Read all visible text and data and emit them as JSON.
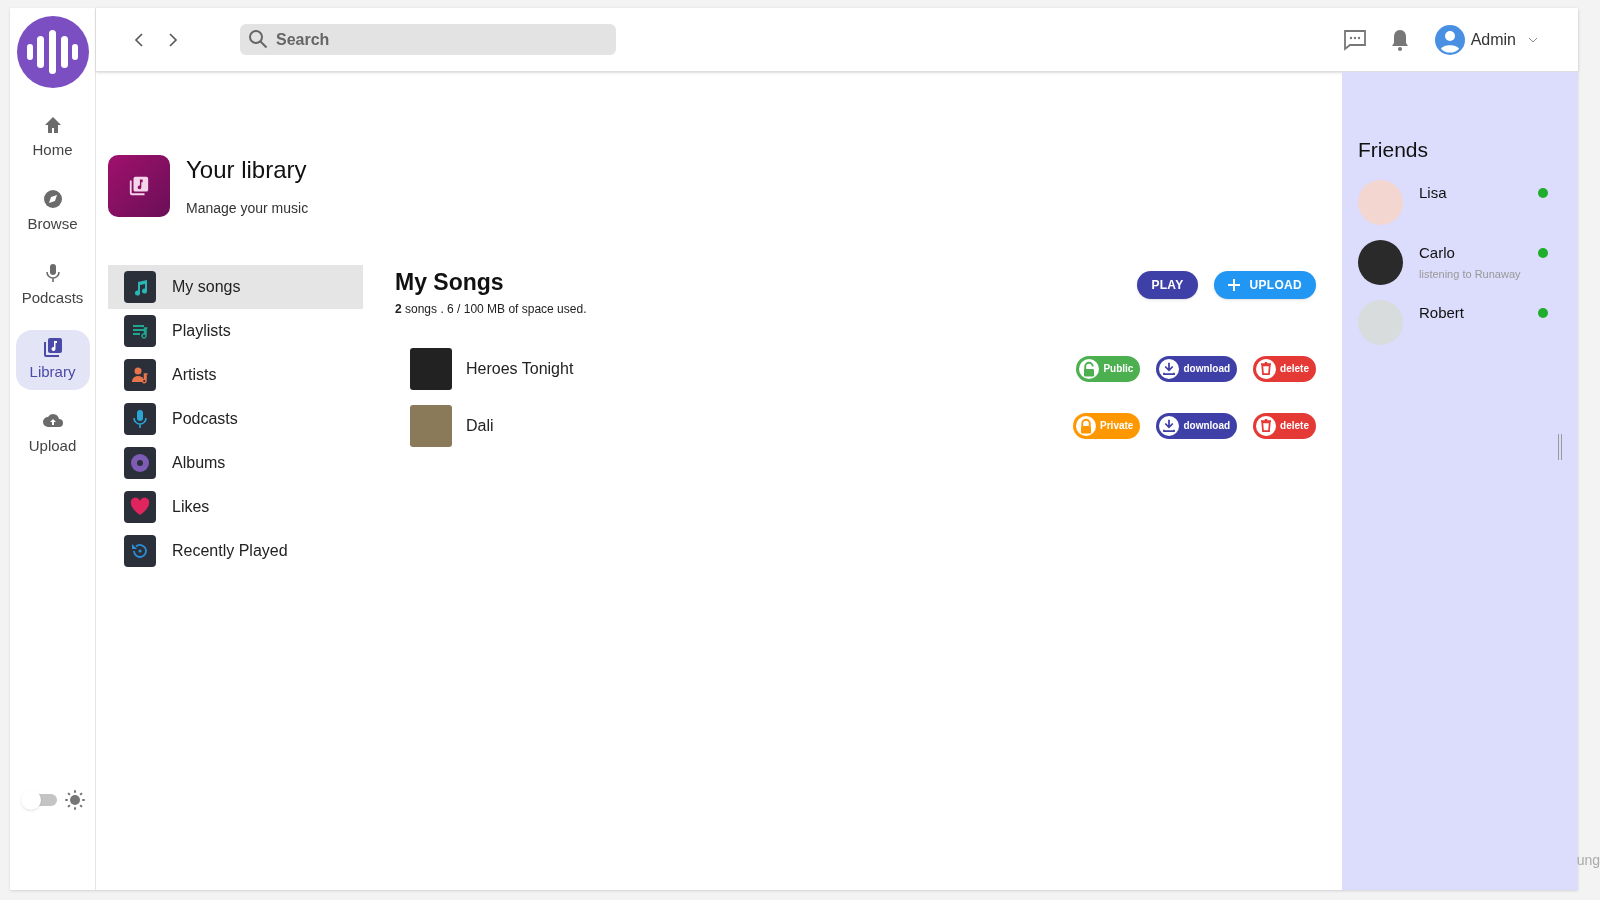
{
  "nav": {
    "items": [
      {
        "label": "Home",
        "selected": false
      },
      {
        "label": "Browse",
        "selected": false
      },
      {
        "label": "Podcasts",
        "selected": false
      },
      {
        "label": "Library",
        "selected": true
      },
      {
        "label": "Upload",
        "selected": false
      }
    ],
    "theme_toggle": {
      "on": false
    }
  },
  "topbar": {
    "search": {
      "placeholder": "Search"
    },
    "user": "Admin"
  },
  "header": {
    "title": "Your library",
    "subtitle": "Manage your music"
  },
  "library_menu": [
    {
      "label": "My songs",
      "selected": true
    },
    {
      "label": "Playlists",
      "selected": false
    },
    {
      "label": "Artists",
      "selected": false
    },
    {
      "label": "Podcasts",
      "selected": false
    },
    {
      "label": "Albums",
      "selected": false
    },
    {
      "label": "Likes",
      "selected": false
    },
    {
      "label": "Recently Played",
      "selected": false
    }
  ],
  "songs_panel": {
    "title": "My Songs",
    "summary": "**2** songs . 6 / 100 MB of space used.",
    "play_button": "PLAY",
    "upload_button": "UPLOAD",
    "songs": [
      {
        "title": "Heroes Tonight",
        "visibility": {
          "kind": "public",
          "label": "Public"
        },
        "download": "download",
        "delete": "delete"
      },
      {
        "title": "Dali",
        "visibility": {
          "kind": "private",
          "label": "Private"
        },
        "download": "download",
        "delete": "delete"
      }
    ]
  },
  "friends": {
    "title": "Friends",
    "items": [
      {
        "name": "Lisa",
        "online": true
      },
      {
        "name": "Carlo",
        "activity": "listening to Runaway",
        "online": true
      },
      {
        "name": "Robert",
        "online": true
      }
    ]
  },
  "edge_text": "ung"
}
